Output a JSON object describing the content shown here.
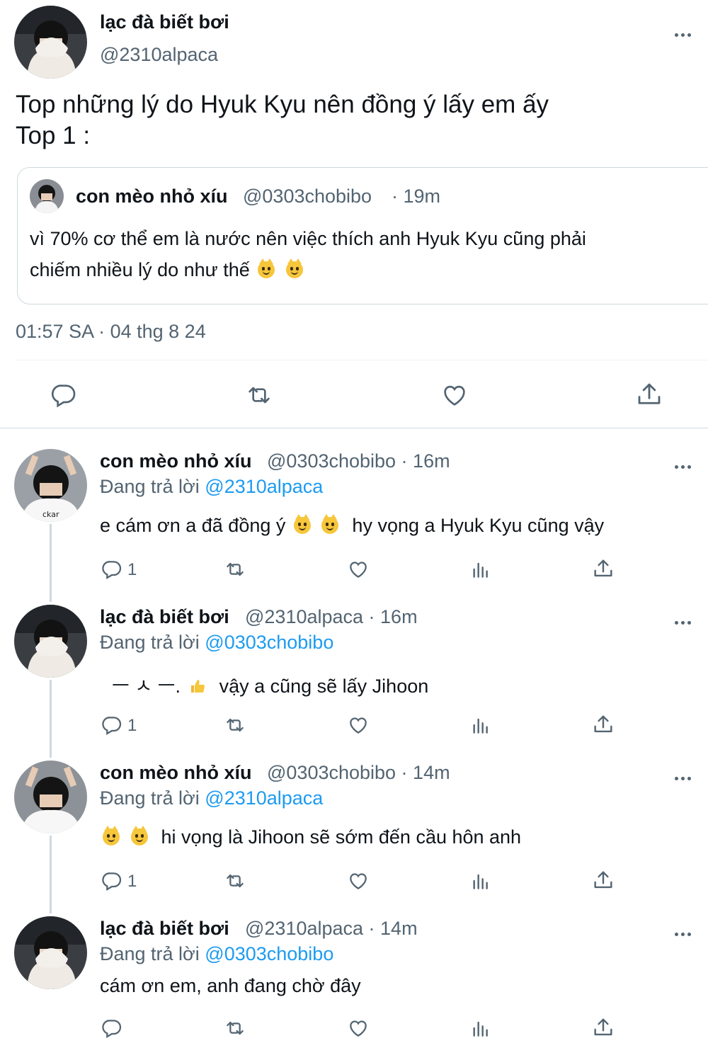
{
  "main_tweet": {
    "author_name": "lạc đà biết bơi",
    "author_handle": "@2310alpaca",
    "text_line1": "Top những lý do Hyuk Kyu nên đồng ý lấy em ấy",
    "text_line2": "Top 1 :",
    "timestamp": "01:57 SA · 04 thg 8 24"
  },
  "quote": {
    "author_name": "con mèo nhỏ xíu",
    "author_handle": "@0303chobibo",
    "time": "· 19m",
    "text_line1": "vì 70% cơ thể em là nước nên việc thích anh Hyuk Kyu cũng phải",
    "text_line2": "chiếm nhiều lý do như thế"
  },
  "replies": [
    {
      "author_name": "con mèo nhỏ xíu",
      "author_handle": "@0303chobibo · 16m",
      "reply_prefix": "Đang trả lời",
      "reply_to": "@2310alpaca",
      "text_before": "e cám ơn a đã đồng ý",
      "text_after": "hy vọng a Hyuk Kyu cũng vậy",
      "reply_count": "1"
    },
    {
      "author_name": "lạc đà biết bơi",
      "author_handle": "@2310alpaca · 16m",
      "reply_prefix": "Đang trả lời",
      "reply_to": "@0303chobibo",
      "text_before": "ㅡ ㅅ ㅡ.",
      "text_after": "vậy a cũng sẽ lấy Jihoon",
      "reply_count": "1"
    },
    {
      "author_name": "con mèo nhỏ xíu",
      "author_handle": "@0303chobibo · 14m",
      "reply_prefix": "Đang trả lời",
      "reply_to": "@2310alpaca",
      "text_after": "hi vọng là Jihoon sẽ sớm đến cầu hôn anh",
      "reply_count": "1"
    },
    {
      "author_name": "lạc đà biết bơi",
      "author_handle": "@2310alpaca · 14m",
      "reply_prefix": "Đang trả lời",
      "reply_to": "@0303chobibo",
      "text_after": "cám ơn em, anh đang chờ đây",
      "reply_count": ""
    }
  ],
  "icons": {
    "reply": "reply-icon",
    "retweet": "retweet-icon",
    "like": "like-icon",
    "views": "views-icon",
    "share": "share-icon",
    "more": "more-icon"
  },
  "colors": {
    "link": "#1d9bf0",
    "muted": "#536471",
    "text": "#0f1419",
    "divider": "#eff3f4"
  }
}
